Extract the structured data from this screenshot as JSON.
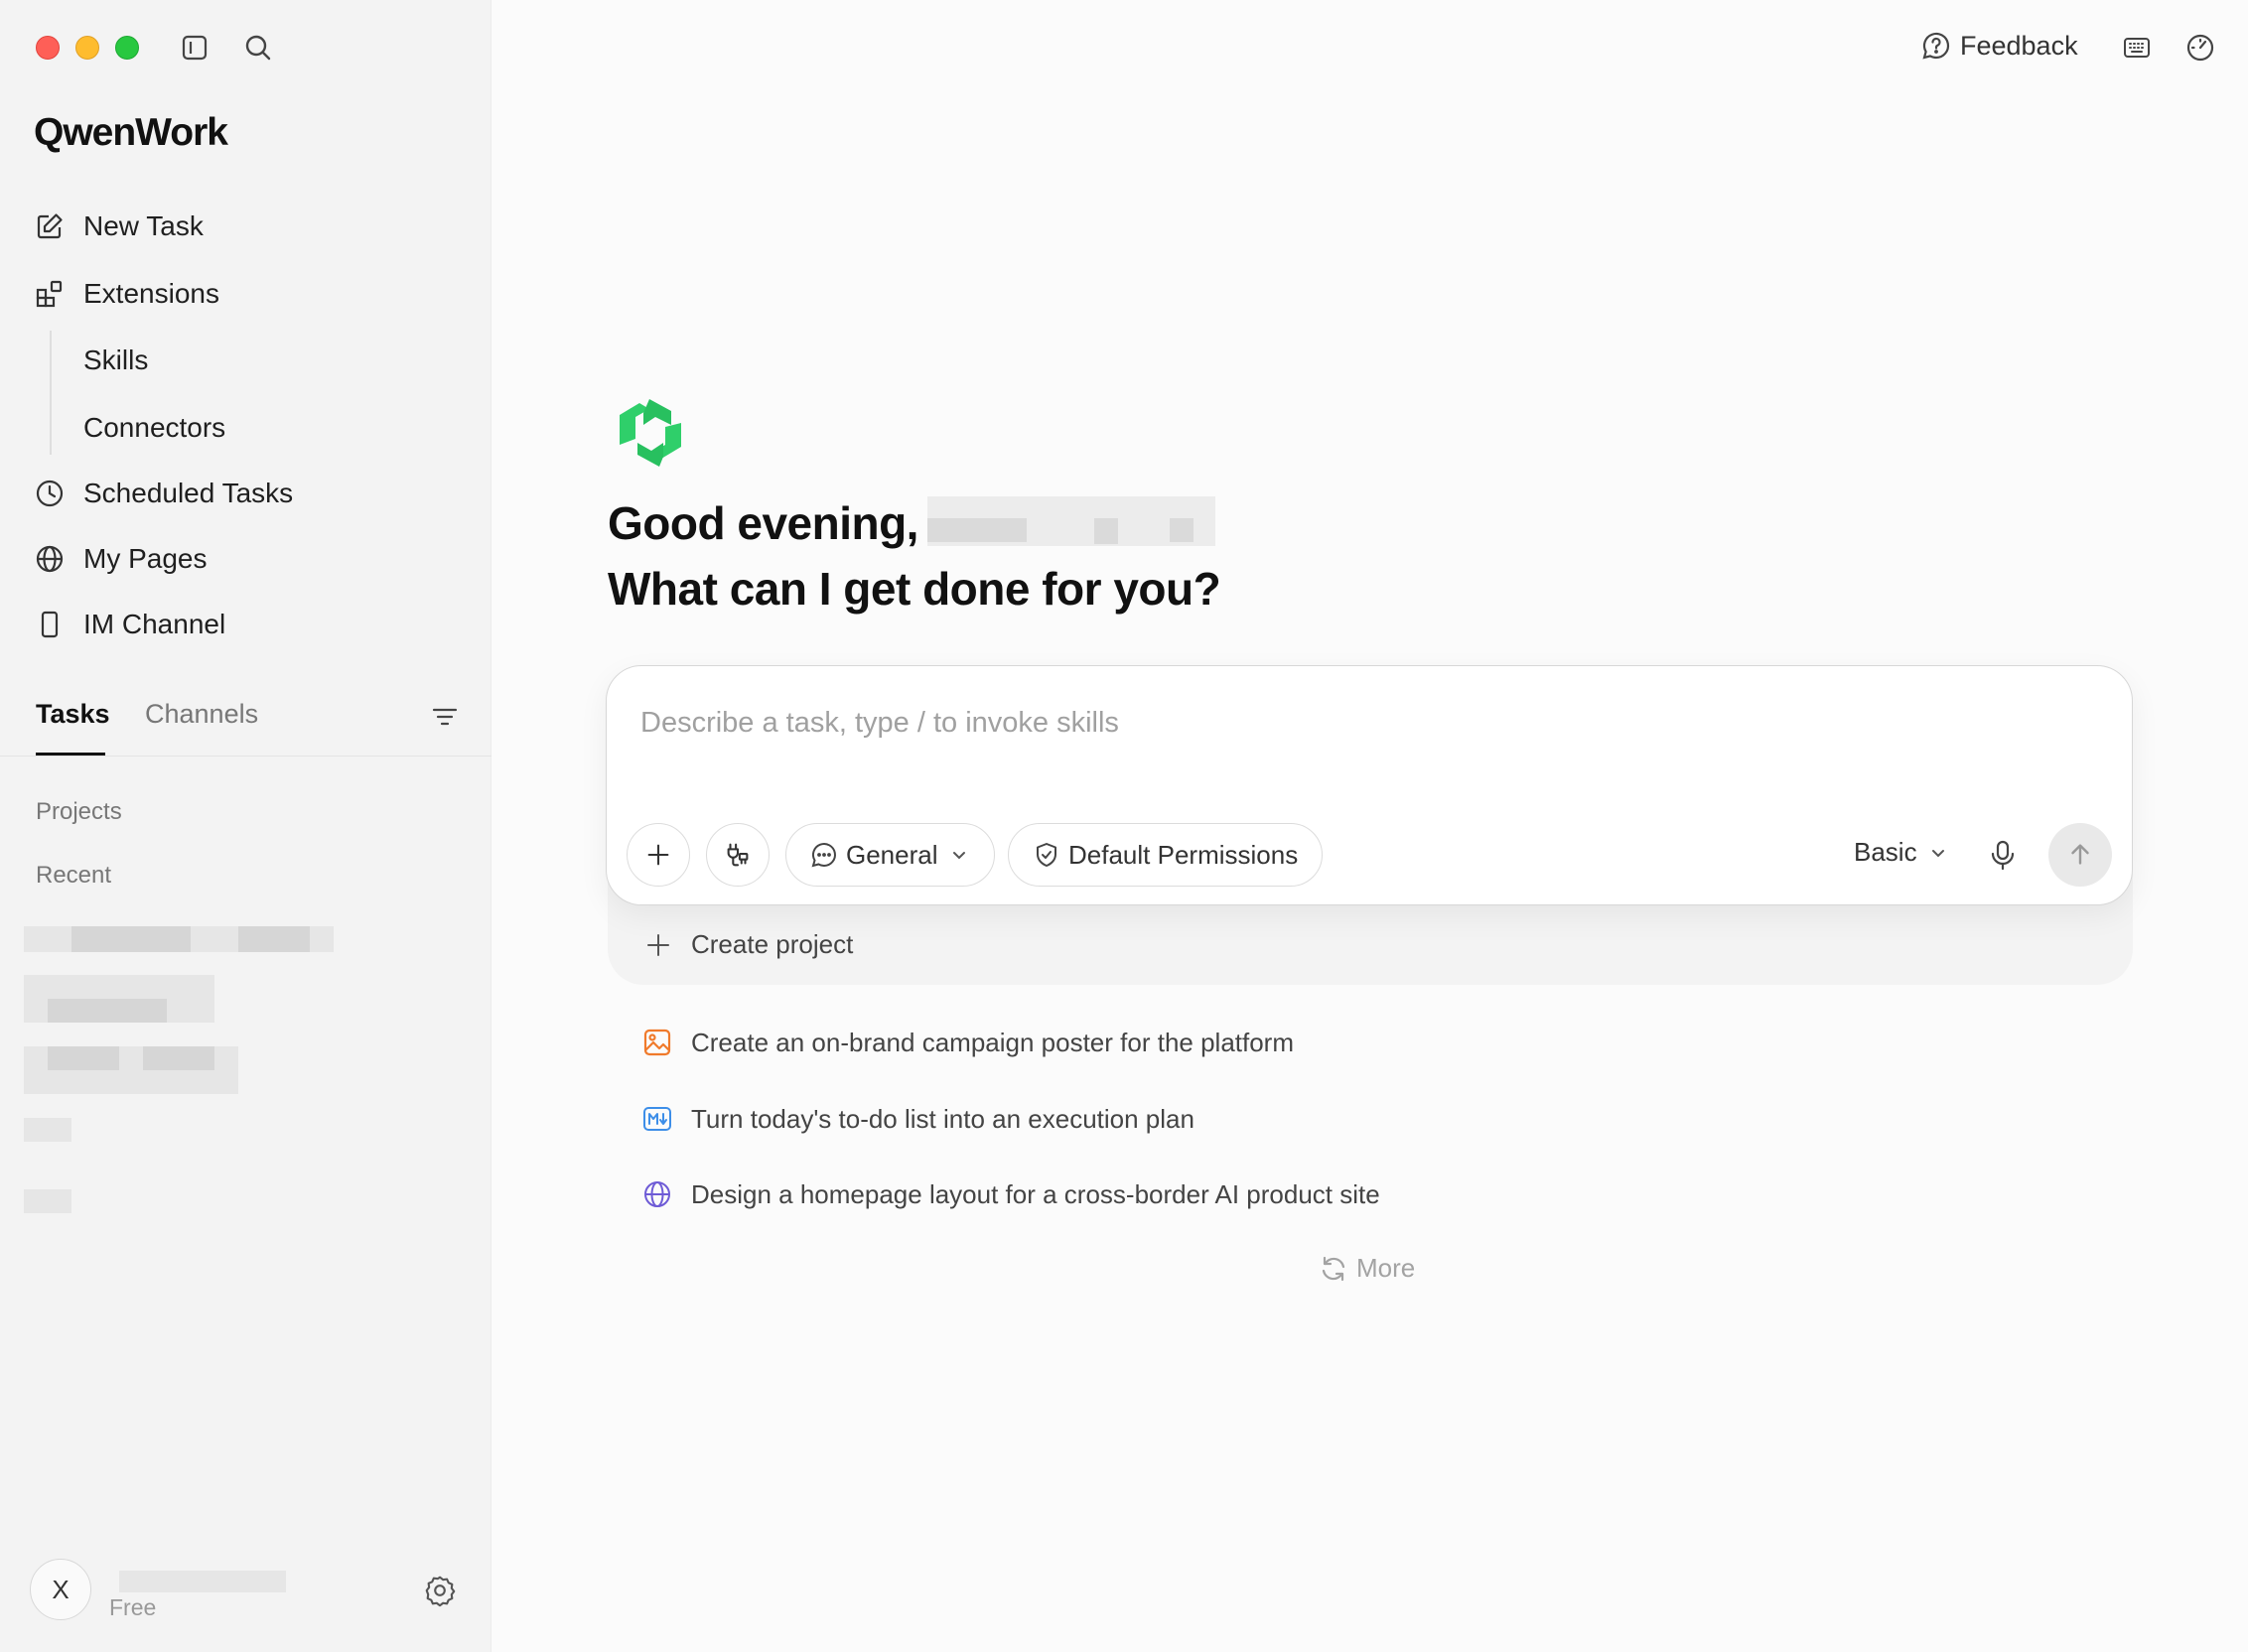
{
  "app": {
    "name": "QwenWork"
  },
  "header": {
    "feedback_label": "Feedback"
  },
  "sidebar": {
    "nav": [
      {
        "label": "New Task",
        "icon": "edit-icon"
      },
      {
        "label": "Extensions",
        "icon": "extensions-icon"
      },
      {
        "label": "Skills"
      },
      {
        "label": "Connectors"
      },
      {
        "label": "Scheduled Tasks",
        "icon": "clock-icon"
      },
      {
        "label": "My Pages",
        "icon": "globe-icon"
      },
      {
        "label": "IM Channel",
        "icon": "phone-icon"
      }
    ],
    "tabs": [
      {
        "label": "Tasks",
        "active": true
      },
      {
        "label": "Channels",
        "active": false
      }
    ],
    "sections": {
      "projects": "Projects",
      "recent": "Recent"
    },
    "user": {
      "initial": "X",
      "plan": "Free"
    }
  },
  "main": {
    "greeting_line1": "Good evening,",
    "greeting_line2": "What can I get done for you?",
    "composer": {
      "placeholder": "Describe a task, type / to invoke skills",
      "mode_label": "General",
      "permissions_label": "Default Permissions",
      "model_label": "Basic"
    },
    "create_project_label": "Create project",
    "suggestions": [
      {
        "text": "Create an on-brand campaign poster for the platform",
        "icon": "image-icon",
        "color": "#f07a2b"
      },
      {
        "text": "Turn today's to-do list into an execution plan",
        "icon": "markdown-icon",
        "color": "#3d8ee8"
      },
      {
        "text": "Design a homepage layout for a cross-border AI product site",
        "icon": "globe-icon",
        "color": "#6e5bd6"
      }
    ],
    "more_label": "More"
  },
  "colors": {
    "brand_green": "#2fcf6a",
    "sidebar_bg": "#f3f3f3",
    "traffic_red": "#fe5f57",
    "traffic_yellow": "#febc2e",
    "traffic_green": "#28c840"
  }
}
